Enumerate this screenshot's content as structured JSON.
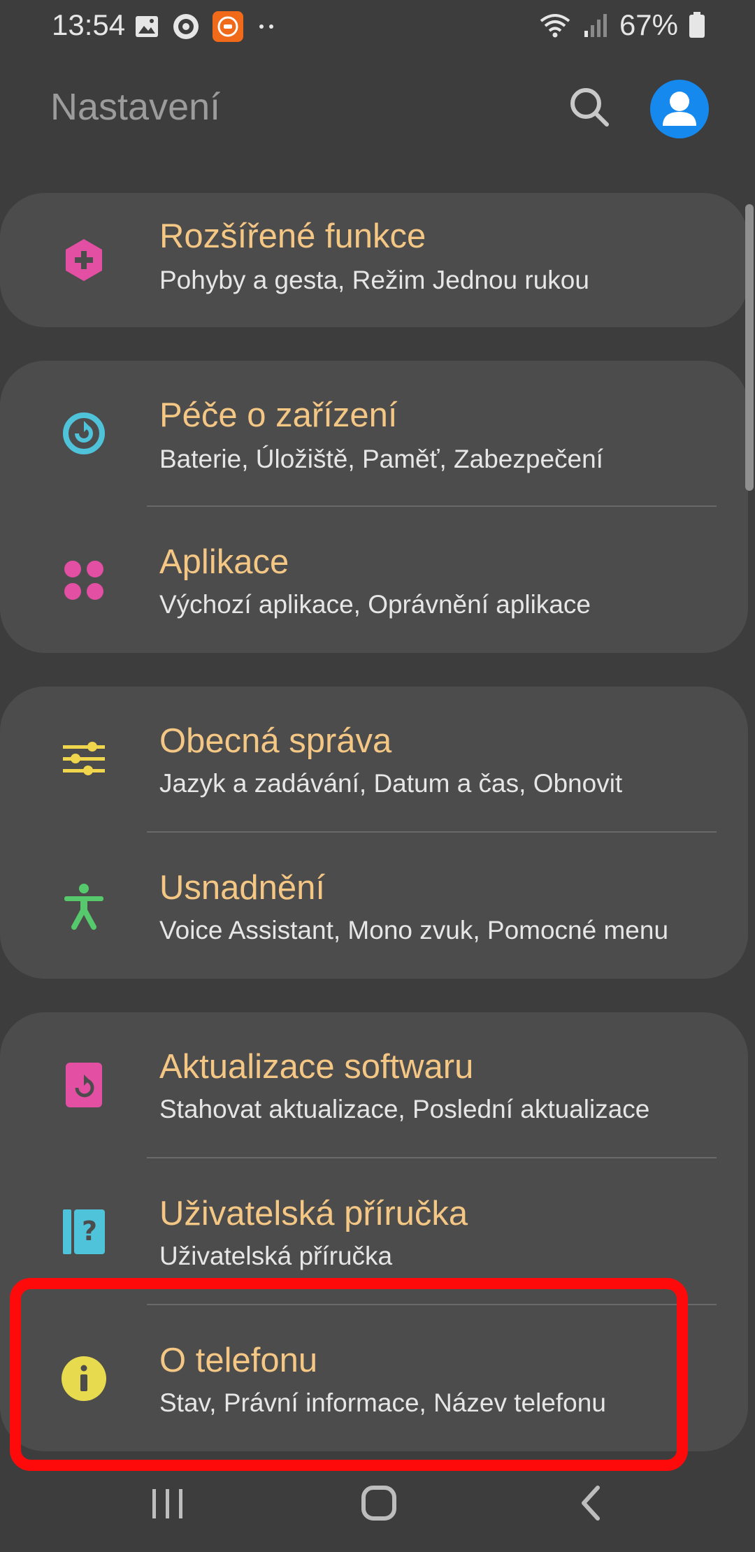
{
  "status_bar": {
    "time": "13:54",
    "battery": "67%",
    "icons": [
      "image-icon",
      "record-icon",
      "mi-app-icon",
      "more-dots-icon",
      "wifi-icon",
      "signal-icon",
      "battery-icon"
    ]
  },
  "header": {
    "title": "Nastavení",
    "search_icon": "search-icon",
    "avatar_icon": "account-icon"
  },
  "colors": {
    "background": "#3e3d3d",
    "card": "#4d4c4c",
    "title_text": "#f5c785",
    "subtitle_text": "#e6e6e6",
    "accent_blue": "#1589ee",
    "highlight_red": "#ff0a0a"
  },
  "items": [
    {
      "icon": "advanced-features-icon",
      "title": "Rozšířené funkce",
      "subtitle": "Pohyby a gesta, Režim Jednou rukou"
    },
    {
      "icon": "device-care-icon",
      "title": "Péče o zařízení",
      "subtitle": "Baterie, Úložiště, Paměť, Zabezpečení"
    },
    {
      "icon": "apps-icon",
      "title": "Aplikace",
      "subtitle": "Výchozí aplikace, Oprávnění aplikace"
    },
    {
      "icon": "general-management-icon",
      "title": "Obecná správa",
      "subtitle": "Jazyk a zadávání, Datum a čas, Obnovit"
    },
    {
      "icon": "accessibility-icon",
      "title": "Usnadnění",
      "subtitle": "Voice Assistant, Mono zvuk, Pomocné menu"
    },
    {
      "icon": "software-update-icon",
      "title": "Aktualizace softwaru",
      "subtitle": "Stahovat aktualizace, Poslední aktualizace"
    },
    {
      "icon": "user-manual-icon",
      "title": "Uživatelská příručka",
      "subtitle": "Uživatelská příručka"
    },
    {
      "icon": "about-phone-icon",
      "title": "O telefonu",
      "subtitle": "Stav, Právní informace, Název telefonu"
    }
  ],
  "nav_bar": {
    "recents_icon": "recents-icon",
    "home_icon": "home-icon",
    "back_icon": "back-icon"
  }
}
